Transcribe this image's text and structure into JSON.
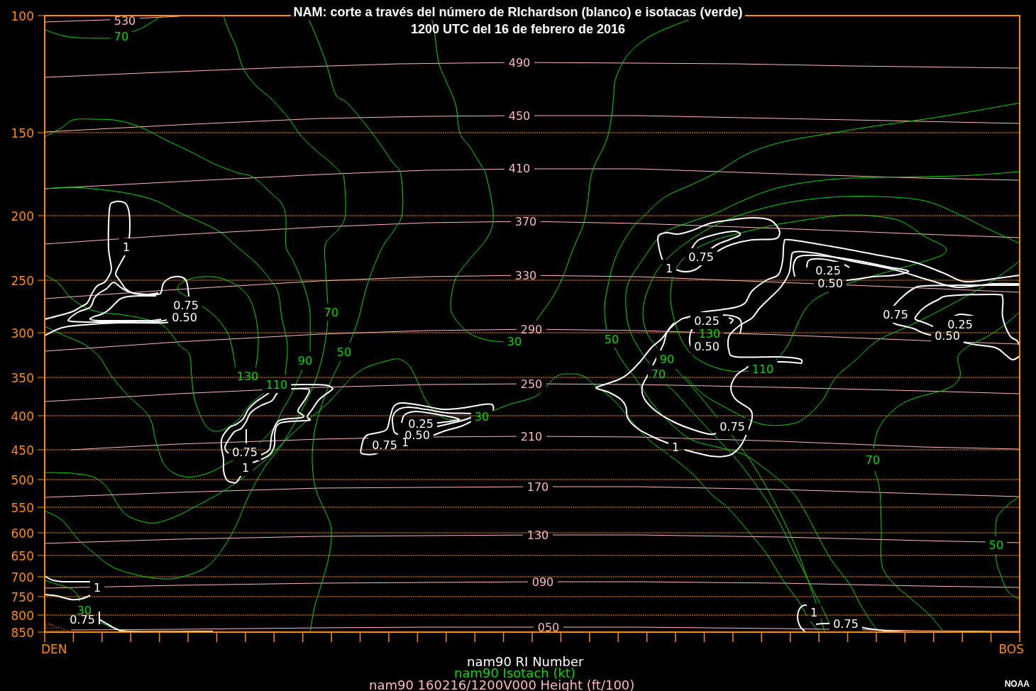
{
  "title": "NAM: corte a través del número de RIchardson (blanco) e isotacas (verde)",
  "subtitle": "1200 UTC del 16 de febrero de 2016",
  "cross_section": {
    "pressure_levels": [
      "100",
      "150",
      "200",
      "250",
      "300",
      "350",
      "400",
      "450",
      "500",
      "550",
      "600",
      "650",
      "700",
      "750",
      "800",
      "850"
    ],
    "start_station": "DEN",
    "end_station": "BOS",
    "height_labels": [
      "530",
      "490",
      "450",
      "410",
      "370",
      "330",
      "290",
      "250",
      "210",
      "170",
      "130",
      "090",
      "050"
    ],
    "isotach_labels": [
      "70",
      "70",
      "30",
      "50",
      "130",
      "90",
      "50",
      "90",
      "130",
      "70",
      "110",
      "110",
      "30",
      "70",
      "50",
      "30"
    ],
    "richardson_labels": [
      "1",
      "0.75",
      "1",
      "0.25",
      "0.50",
      "0.75",
      "0.50",
      "0.75",
      "0.25",
      "0.25",
      "0.50",
      "0.50",
      "0.25",
      "0.75",
      "0.50",
      "0.75",
      "1",
      "0.75",
      "1",
      "1",
      "1",
      "1",
      "0.75",
      "0.75"
    ]
  },
  "legend": [
    {
      "kind": "richardson",
      "text": "nam90 RI Number"
    },
    {
      "kind": "isotach",
      "text": "nam90 Isotach (kt)"
    },
    {
      "kind": "height",
      "text": "nam90 160216/1200V000 Height (ft/100)"
    }
  ],
  "credit": "NOAA"
}
